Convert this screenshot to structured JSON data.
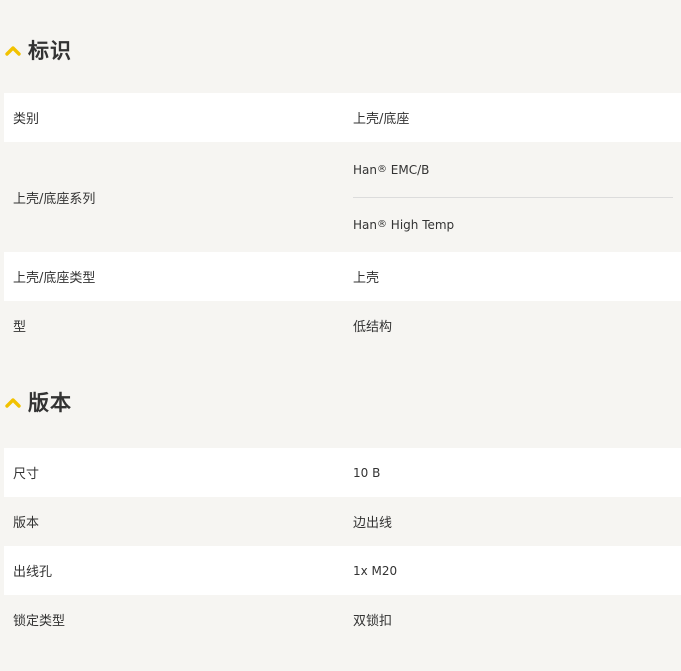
{
  "sections": [
    {
      "title": "标识",
      "rows": [
        {
          "label": "类别",
          "value": "上壳/底座"
        },
        {
          "label": "上壳/底座系列",
          "values": [
            {
              "name": "Han",
              "mark": "®",
              "suffix": " EMC/B"
            },
            {
              "name": "Han",
              "mark": "®",
              "suffix": " High Temp"
            }
          ]
        },
        {
          "label": "上壳/底座类型",
          "value": "上壳"
        },
        {
          "label": "型",
          "value": "低结构"
        }
      ]
    },
    {
      "title": "版本",
      "rows": [
        {
          "label": "尺寸",
          "value": "10 B"
        },
        {
          "label": "版本",
          "value": "边出线"
        },
        {
          "label": "出线孔",
          "value": "1x M20"
        },
        {
          "label": "锁定类型",
          "value": "双锁扣"
        }
      ]
    }
  ],
  "colors": {
    "accent": "#f2c200",
    "background": "#f6f5f2",
    "row_white": "#ffffff",
    "text": "#333333"
  },
  "icons": {
    "section_toggle": "chevron-up-icon"
  }
}
